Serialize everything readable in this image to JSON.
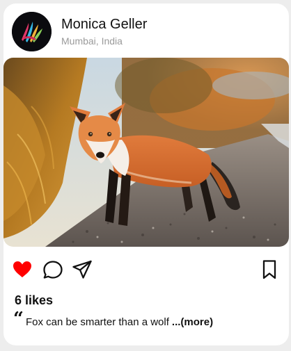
{
  "post": {
    "user": {
      "name": "Monica Geller",
      "location": "Mumbai, India",
      "avatar_icon": "feather-logo-icon"
    },
    "image": {
      "subject_icon": "fox-photo"
    },
    "actions": {
      "like_icon": "heart-icon",
      "comment_icon": "comment-bubble-icon",
      "share_icon": "paper-plane-icon",
      "save_icon": "bookmark-icon",
      "liked": true
    },
    "likes_label": "6 likes",
    "caption": {
      "quote": "“",
      "text": "Fox can be smarter than a wolf",
      "more_label": "...(more)"
    }
  },
  "colors": {
    "heart": "#ff0000",
    "icon_stroke": "#111111",
    "location": "#9a9a9a",
    "card": "#ffffff"
  }
}
